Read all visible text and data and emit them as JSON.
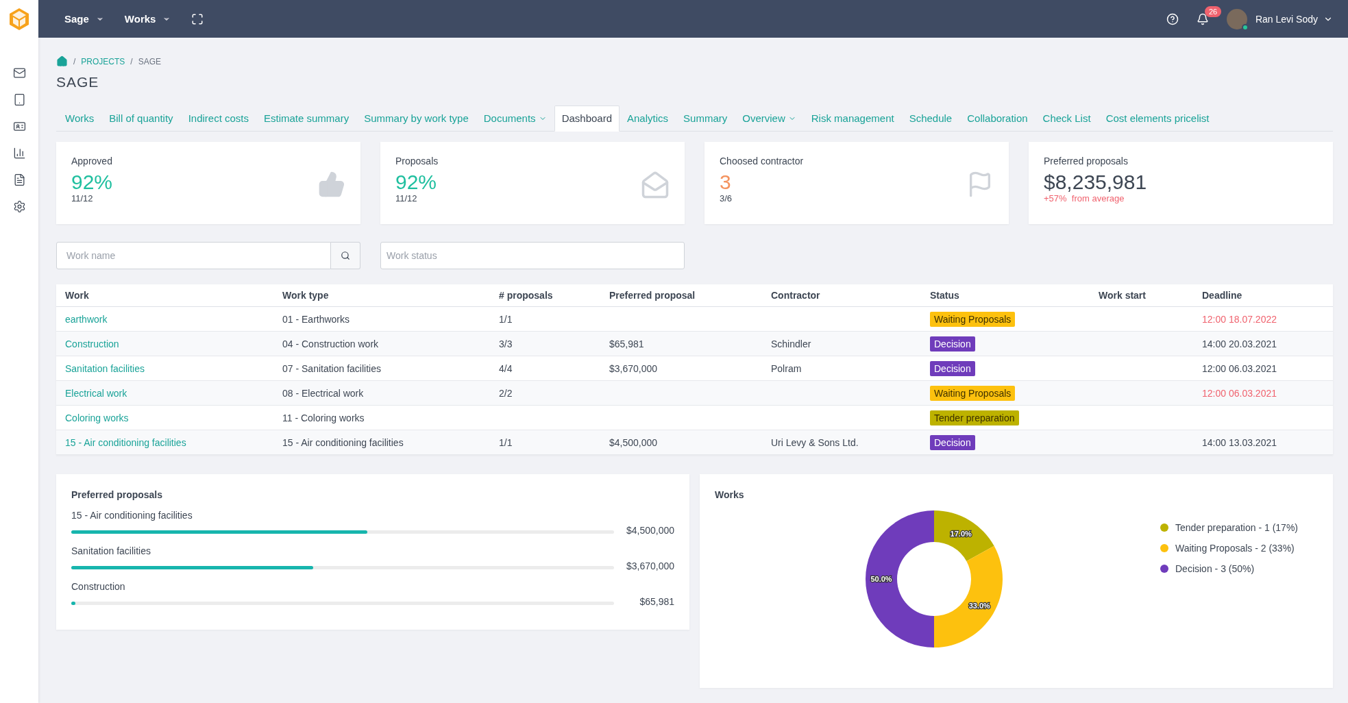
{
  "topbar": {
    "menus": [
      {
        "label": "Sage"
      },
      {
        "label": "Works"
      }
    ],
    "notifications": "26",
    "user": "Ran Levi Sody"
  },
  "breadcrumb": {
    "separator": "/",
    "items": [
      "PROJECTS",
      "SAGE"
    ]
  },
  "title": "SAGE",
  "tabs": [
    {
      "label": "Works",
      "selected": false,
      "dropdown": false
    },
    {
      "label": "Bill of quantity",
      "selected": false,
      "dropdown": false
    },
    {
      "label": "Indirect costs",
      "selected": false,
      "dropdown": false
    },
    {
      "label": "Estimate summary",
      "selected": false,
      "dropdown": false
    },
    {
      "label": "Summary by work type",
      "selected": false,
      "dropdown": false
    },
    {
      "label": "Documents",
      "selected": false,
      "dropdown": true
    },
    {
      "label": "Dashboard",
      "selected": true,
      "dropdown": false
    },
    {
      "label": "Analytics",
      "selected": false,
      "dropdown": false
    },
    {
      "label": "Summary",
      "selected": false,
      "dropdown": false
    },
    {
      "label": "Overview",
      "selected": false,
      "dropdown": true
    },
    {
      "label": "Risk management",
      "selected": false,
      "dropdown": false
    },
    {
      "label": "Schedule",
      "selected": false,
      "dropdown": false
    },
    {
      "label": "Collaboration",
      "selected": false,
      "dropdown": false
    },
    {
      "label": "Check List",
      "selected": false,
      "dropdown": false
    },
    {
      "label": "Cost elements pricelist",
      "selected": false,
      "dropdown": false
    }
  ],
  "cards": [
    {
      "kind": "approved",
      "title": "Approved",
      "value": "92%",
      "sub": "11/12",
      "color": "#1fbf9f"
    },
    {
      "kind": "proposals",
      "title": "Proposals",
      "value": "92%",
      "sub": "11/12",
      "color": "#1fbf9f"
    },
    {
      "kind": "contractor",
      "title": "Choosed contractor",
      "value": "3",
      "sub": "3/6",
      "color": "#f4935f"
    },
    {
      "kind": "money",
      "title": "Preferred proposals",
      "value": "$8,235,981",
      "sub": "+57%  from average",
      "color": "#3d4653"
    }
  ],
  "filters": {
    "work_name": {
      "placeholder": "Work name"
    },
    "work_status": {
      "placeholder": "Work status"
    }
  },
  "table": {
    "columns": [
      "Work",
      "Work type",
      "# proposals",
      "Preferred proposal",
      "Contractor",
      "Status",
      "Work start",
      "Deadline"
    ],
    "rows": [
      {
        "work": "earthwork",
        "type": "01 - Earthworks",
        "proposals": "1/1",
        "preferred": "",
        "contractor": "",
        "status": {
          "label": "Waiting Proposals",
          "color": "#fdc10e"
        },
        "start": "",
        "deadline": "12:00 18.07.2022",
        "overdue": true
      },
      {
        "work": "Construction",
        "type": "04 - Construction work",
        "proposals": "3/3",
        "preferred": "$65,981",
        "contractor": "Schindler",
        "status": {
          "label": "Decision",
          "color": "#6f3cbb"
        },
        "start": "",
        "deadline": "14:00 20.03.2021",
        "overdue": false
      },
      {
        "work": "Sanitation facilities",
        "type": "07 - Sanitation facilities",
        "proposals": "4/4",
        "preferred": "$3,670,000",
        "contractor": "Polram",
        "status": {
          "label": "Decision",
          "color": "#6f3cbb"
        },
        "start": "",
        "deadline": "12:00 06.03.2021",
        "overdue": false
      },
      {
        "work": "Electrical work",
        "type": "08 - Electrical work",
        "proposals": "2/2",
        "preferred": "",
        "contractor": "",
        "status": {
          "label": "Waiting Proposals",
          "color": "#fdc10e"
        },
        "start": "",
        "deadline": "12:00 06.03.2021",
        "overdue": true
      },
      {
        "work": "Coloring works",
        "type": "11 - Coloring works",
        "proposals": "",
        "preferred": "",
        "contractor": "",
        "status": {
          "label": "Tender preparation",
          "color": "#bdb200"
        },
        "start": "",
        "deadline": ""
      },
      {
        "work": "15 - Air conditioning facilities",
        "type": "15 - Air conditioning facilities",
        "proposals": "1/1",
        "preferred": "$4,500,000",
        "contractor": "Uri Levy & Sons Ltd.",
        "status": {
          "label": "Decision",
          "color": "#6f3cbb"
        },
        "start": "",
        "deadline": "14:00 13.03.2021",
        "overdue": false
      }
    ]
  },
  "preferred_panel": {
    "title": "Preferred proposals",
    "items": [
      {
        "name": "15 - Air conditioning facilities",
        "value": "$4,500,000",
        "level": 0.546
      },
      {
        "name": "Sanitation facilities",
        "value": "$3,670,000",
        "level": 0.446
      },
      {
        "name": "Construction",
        "value": "$65,981",
        "level": 0.008
      }
    ]
  },
  "works_panel": {
    "title": "Works",
    "chart_data": {
      "type": "donut",
      "categories": [
        "Tender preparation - 1 (17%)",
        "Waiting Proposals - 2 (33%)",
        "Decision - 3 (50%)"
      ],
      "values": [
        17,
        33,
        50
      ],
      "legend": "right",
      "colors": [
        "#bdb200",
        "#fdc10e",
        "#6f3cbb"
      ],
      "value_labels": [
        "17.0%",
        "33.0%",
        "50.0%"
      ]
    }
  }
}
